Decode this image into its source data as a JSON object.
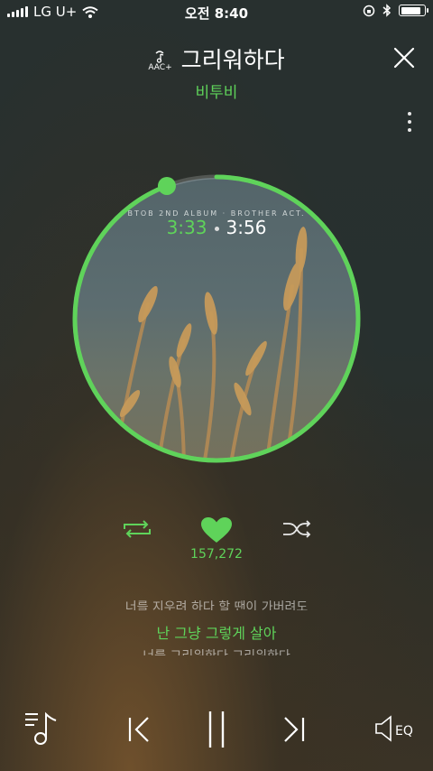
{
  "status_bar": {
    "carrier": "LG U+",
    "time": "오전 8:40",
    "battery_level": 0.9
  },
  "header": {
    "title": "그리워하다",
    "artist": "비투비",
    "codec_label": "AAC+"
  },
  "album": {
    "caption": "BTOB 2ND ALBUM · BROTHER ACT.",
    "progress_fraction": 0.943
  },
  "playback": {
    "current_time": "3:33",
    "total_time": "3:56",
    "like_count": "157,272"
  },
  "lyrics": {
    "previous": "너를 지우려 하다 할 땐이 가버려도",
    "current": "난 그냥 그렇게 살아",
    "next": "너를 그리워한다 그리워한다"
  },
  "bottom_bar": {
    "eq_label": "EQ"
  },
  "colors": {
    "accent": "#5fd35a",
    "background": "#28302f"
  },
  "icons": [
    "signal-icon",
    "wifi-icon",
    "rotation-lock-icon",
    "bluetooth-icon",
    "battery-icon",
    "hires-icon",
    "close-icon",
    "more-icon",
    "repeat-icon",
    "heart-icon",
    "shuffle-icon",
    "playlist-icon",
    "previous-icon",
    "pause-icon",
    "next-icon",
    "eq-icon"
  ]
}
